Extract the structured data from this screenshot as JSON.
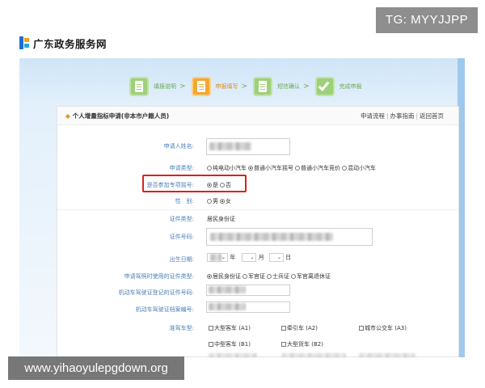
{
  "watermarks": {
    "top": "TG: MYYJJPP",
    "bottom": "www.yihaoyulepgdown.org"
  },
  "site": {
    "name": "广东政务服务网"
  },
  "colors": {
    "frame": "#cfe5f8",
    "accent_orange": "#f3a731",
    "accent_green": "#9ed07a",
    "label_blue": "#4a7fb8",
    "highlight_red": "#d9211f"
  },
  "steps": [
    {
      "label": "填报说明",
      "active": false,
      "icon": "document-icon"
    },
    {
      "label": "申报填写",
      "active": true,
      "icon": "edit-icon"
    },
    {
      "label": "短信确认",
      "active": false,
      "icon": "message-icon"
    },
    {
      "label": "完成申报",
      "active": false,
      "icon": "check-icon"
    }
  ],
  "panel": {
    "title": "个人增量指标申请(非本市户籍人员)",
    "links": [
      "申请流程",
      "办事指南",
      "返回首页"
    ]
  },
  "form": {
    "name_label": "申请人姓名:",
    "type_label": "申请类型:",
    "type_options": [
      {
        "label": "纯电动小汽车",
        "checked": false
      },
      {
        "label": "普通小汽车摇号",
        "checked": true
      },
      {
        "label": "普通小汽车竞价",
        "checked": false
      },
      {
        "label": "混动小汽车",
        "checked": false
      }
    ],
    "special_label": "是否参加专项摇号:",
    "special_options": [
      {
        "label": "是",
        "checked": true
      },
      {
        "label": "否",
        "checked": false
      }
    ],
    "gender_label": "性　别:",
    "gender_options": [
      {
        "label": "男",
        "checked": false
      },
      {
        "label": "女",
        "checked": true
      }
    ],
    "id_type_label": "证件类型:",
    "id_type_value": "居民身份证",
    "id_number_label": "证件号码:",
    "birth_label": "出生日期:",
    "birth_year_unit": "年",
    "birth_month_unit": "月",
    "birth_day_unit": "日",
    "license_cert_label": "申请驾照时使用的证件类型:",
    "license_cert_options": [
      {
        "label": "居民身份证",
        "checked": true
      },
      {
        "label": "军官证",
        "checked": false
      },
      {
        "label": "士兵证",
        "checked": false
      },
      {
        "label": "军官离退休证",
        "checked": false
      }
    ],
    "license_id_label": "机动车驾驶证登记的证件号码:",
    "license_file_label": "机动车驾驶证档案编号:",
    "vehicle_type_label": "准驾车型:",
    "vehicle_types": [
      {
        "label": "大型客车 (A1)",
        "checked": false
      },
      {
        "label": "牵引车 (A2)",
        "checked": false
      },
      {
        "label": "城市公交车 (A3)",
        "checked": false
      },
      {
        "label": "中型客车 (B1)",
        "checked": false
      },
      {
        "label": "大型货车 (B2)",
        "checked": false
      }
    ]
  }
}
